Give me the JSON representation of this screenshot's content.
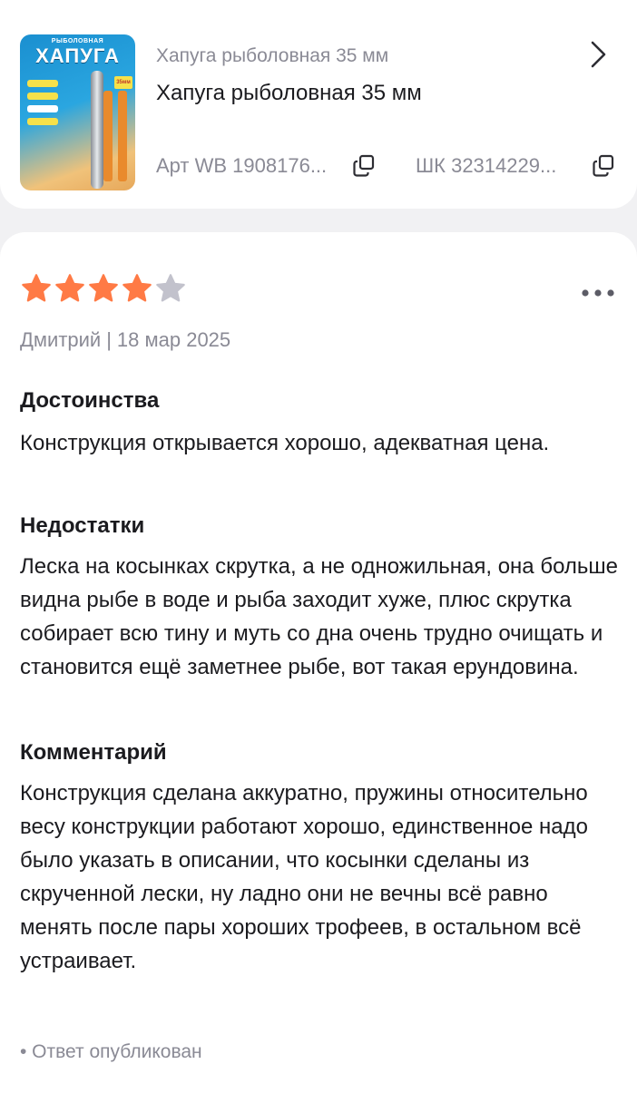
{
  "product": {
    "subtitle": "Хапуга рыболовная 35 мм",
    "title": "Хапуга рыболовная 35 мм",
    "art": "Арт WB 1908176...",
    "shk": "ШК 32314229...",
    "image": {
      "brand_top": "РЫБОЛОВНАЯ",
      "brand": "ХАПУГА",
      "badge": "35мм"
    }
  },
  "review": {
    "rating": 4,
    "max_rating": 5,
    "author": "Дмитрий",
    "separator": "|",
    "date": "18 мар 2025",
    "pros_title": "Достоинства",
    "pros_text": "Конструкция открывается хорошо, адекватная цена.",
    "cons_title": "Недостатки",
    "cons_text": "Леска на косынках скрутка, а не одножильная, она больше видна рыбе в воде и рыба заходит хуже, плюс скрутка собирает всю тину и муть со дна очень трудно очищать и становится ещё заметнее рыбе, вот такая ерундовина.",
    "comment_title": "Комментарий",
    "comment_text": "Конструкция сделана аккуратно, пружины относительно весу конструкции работают хорошо, единственное надо было указать в описании, что косынки сделаны из скрученной лески, ну ладно они не вечны всё равно менять после пары хороших трофеев, в остальном всё устраивает.",
    "answer_status": "• Ответ опубликован"
  },
  "colors": {
    "star_filled": "#ff7a45",
    "star_empty": "#c2c2cc",
    "muted_text": "#8a8a95",
    "background": "#f1f1f3"
  },
  "icons": {
    "chevron": "chevron-right-icon",
    "copy": "copy-icon",
    "more": "more-horizontal-icon",
    "star": "star-icon"
  }
}
